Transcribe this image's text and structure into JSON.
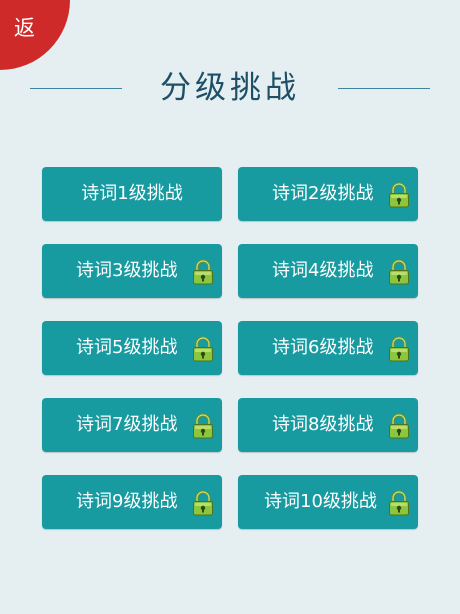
{
  "back": {
    "label": "返"
  },
  "header": {
    "title": "分级挑战"
  },
  "levels": [
    {
      "label": "诗词1级挑战",
      "locked": false
    },
    {
      "label": "诗词2级挑战",
      "locked": true
    },
    {
      "label": "诗词3级挑战",
      "locked": true
    },
    {
      "label": "诗词4级挑战",
      "locked": true
    },
    {
      "label": "诗词5级挑战",
      "locked": true
    },
    {
      "label": "诗词6级挑战",
      "locked": true
    },
    {
      "label": "诗词7级挑战",
      "locked": true
    },
    {
      "label": "诗词8级挑战",
      "locked": true
    },
    {
      "label": "诗词9级挑战",
      "locked": true
    },
    {
      "label": "诗词10级挑战",
      "locked": true
    }
  ],
  "colors": {
    "background": "#e5eff1",
    "back_corner": "#cf2a2a",
    "button": "#179ba1",
    "title": "#1d4f66",
    "lock": "#8cc63e"
  },
  "icons": {
    "lock": "padlock-icon"
  }
}
